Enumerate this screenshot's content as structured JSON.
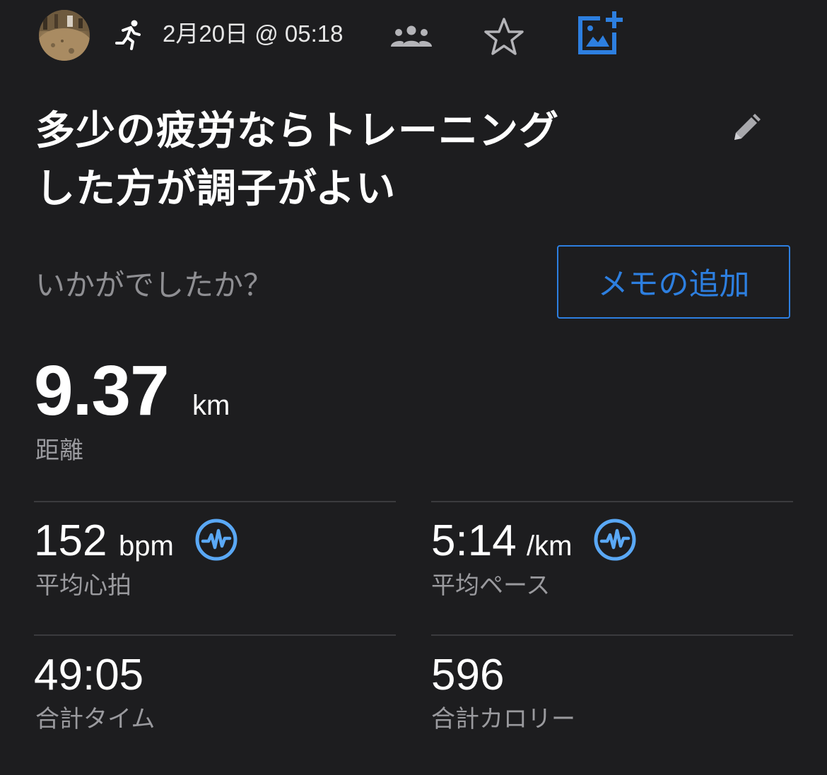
{
  "header": {
    "avatar_icon": "user-avatar-photo",
    "activity_icon": "running-icon",
    "date_time": "2月20日 @ 05:18",
    "group_icon": "group-icon",
    "favorite_icon": "star-icon",
    "add_photo_icon": "add-photo-icon"
  },
  "activity": {
    "title_line1": "多少の疲労ならトレーニング",
    "title_line2": "した方が調子がよい",
    "edit_icon": "pencil-icon",
    "prompt": "いかがでしたか？",
    "memo_button": "メモの追加"
  },
  "distance": {
    "value": "9.37",
    "unit": "km",
    "label": "距離"
  },
  "stats": {
    "heart_rate": {
      "value": "152",
      "unit": "bpm",
      "label": "平均心拍",
      "icon": "pulse-icon"
    },
    "pace": {
      "value": "5:14",
      "unit": "/km",
      "label": "平均ペース",
      "icon": "pulse-icon"
    },
    "time": {
      "value": "49:05",
      "label": "合計タイム"
    },
    "calories": {
      "value": "596",
      "label": "合計カロリー"
    }
  },
  "colors": {
    "background": "#1d1d1f",
    "accent": "#2d7fe0",
    "pulse_icon": "#5aa8f5",
    "label_gray": "#9a9a9e",
    "divider": "#3b3b3e"
  }
}
